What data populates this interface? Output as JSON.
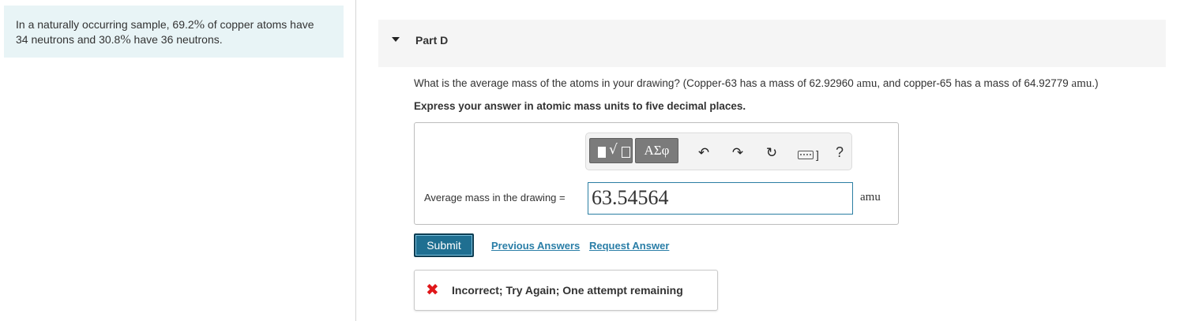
{
  "context": {
    "line1_pre": "In a naturally occurring sample, 69.2",
    "line1_pct": "%",
    "line1_post": " of copper atoms have",
    "line2_pre": "34 neutrons and 30.8",
    "line2_pct": "%",
    "line2_post": " have 36 neutrons."
  },
  "part": {
    "title": "Part D"
  },
  "question": {
    "text_a": "What is the average mass of the atoms in your drawing? (Copper-63 has a mass of 62.92960 ",
    "unit_a": "amu",
    "text_b": ", and copper-65 has a mass of 64.92779 ",
    "unit_b": "amu",
    "text_c": ".)",
    "instruction": "Express your answer in atomic mass units to five decimal places."
  },
  "toolbar": {
    "greek_label": "ΑΣφ",
    "undo_icon": "undo-icon",
    "redo_icon": "redo-icon",
    "reset_icon": "reset-icon",
    "keyboard_icon": "keyboard-icon",
    "help_label": "?"
  },
  "answer": {
    "label": "Average mass in the drawing =",
    "value": "63.54564",
    "unit": "amu"
  },
  "actions": {
    "submit_label": "Submit",
    "previous_answers_label": "Previous Answers",
    "request_answer_label": "Request Answer"
  },
  "feedback": {
    "message": "Incorrect; Try Again; One attempt remaining",
    "icon": "x-icon",
    "icon_color": "#e0171a"
  },
  "colors": {
    "context_bg": "#e8f4f6",
    "link": "#2a7ea7",
    "submit_bg": "#1f6f91"
  }
}
